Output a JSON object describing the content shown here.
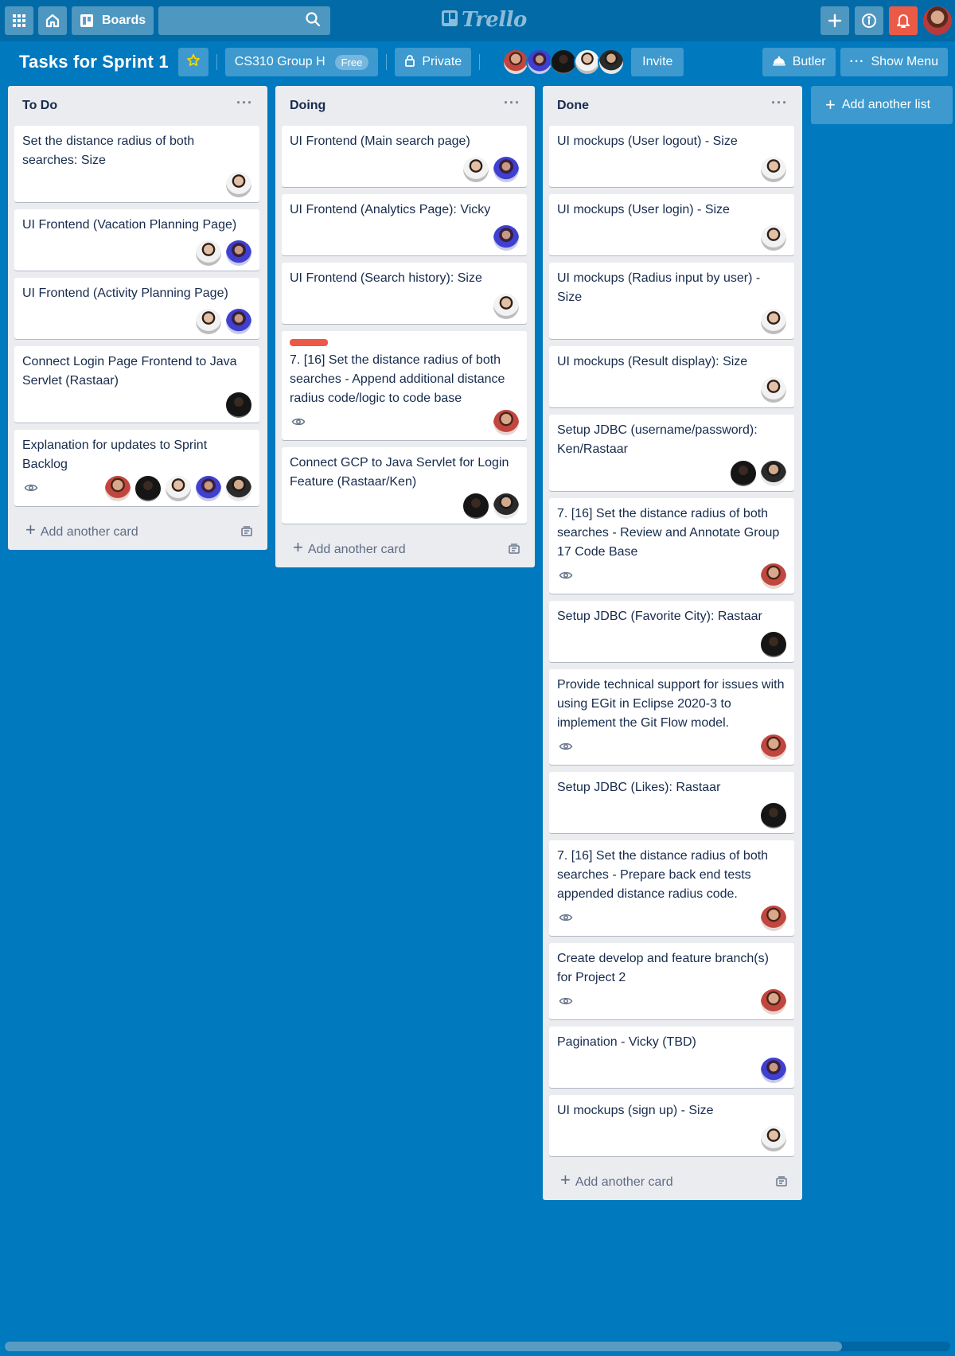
{
  "header": {
    "boards_label": "Boards",
    "search_value": "",
    "logo_text": "Trello"
  },
  "board": {
    "title": "Tasks for Sprint 1",
    "team": "CS310 Group H",
    "team_badge": "Free",
    "visibility": "Private",
    "invite": "Invite",
    "butler": "Butler",
    "show_menu": "Show Menu",
    "members": [
      "red-shirt",
      "blue-dress",
      "dark",
      "white-shirt",
      "suit"
    ]
  },
  "lists": [
    {
      "title": "To Do",
      "add_card": "Add another card",
      "cards": [
        {
          "title": "Set the distance radius of both searches: Size",
          "members": [
            "white-shirt"
          ],
          "watch": false,
          "label": false
        },
        {
          "title": "UI Frontend (Vacation Planning Page)",
          "members": [
            "white-shirt",
            "blue-dress"
          ],
          "watch": false,
          "label": false
        },
        {
          "title": "UI Frontend (Activity Planning Page)",
          "members": [
            "white-shirt",
            "blue-dress"
          ],
          "watch": false,
          "label": false
        },
        {
          "title": "Connect Login Page Frontend to Java Servlet (Rastaar)",
          "members": [
            "dark"
          ],
          "watch": false,
          "label": false
        },
        {
          "title": "Explanation for updates to Sprint Backlog",
          "members": [
            "red-shirt",
            "dark",
            "white-shirt",
            "blue-dress",
            "suit"
          ],
          "watch": true,
          "label": false
        }
      ]
    },
    {
      "title": "Doing",
      "add_card": "Add another card",
      "cards": [
        {
          "title": "UI Frontend (Main search page)",
          "members": [
            "white-shirt",
            "blue-dress"
          ],
          "watch": false,
          "label": false
        },
        {
          "title": "UI Frontend (Analytics Page): Vicky",
          "members": [
            "blue-dress"
          ],
          "watch": false,
          "label": false
        },
        {
          "title": "UI Frontend (Search history): Size",
          "members": [
            "white-shirt"
          ],
          "watch": false,
          "label": false
        },
        {
          "title": "7. [16] Set the distance radius of both searches - Append additional distance radius code/logic to code base",
          "members": [
            "red-shirt"
          ],
          "watch": true,
          "label": true
        },
        {
          "title": "Connect GCP to Java Servlet for Login Feature (Rastaar/Ken)",
          "members": [
            "dark",
            "suit"
          ],
          "watch": false,
          "label": false
        }
      ]
    },
    {
      "title": "Done",
      "add_card": "Add another card",
      "cards": [
        {
          "title": "UI mockups (User logout) - Size",
          "members": [
            "white-shirt"
          ],
          "watch": false,
          "label": false
        },
        {
          "title": "UI mockups (User login) - Size",
          "members": [
            "white-shirt"
          ],
          "watch": false,
          "label": false
        },
        {
          "title": "UI mockups (Radius input by user) - Size",
          "members": [
            "white-shirt"
          ],
          "watch": false,
          "label": false
        },
        {
          "title": "UI mockups (Result display): Size",
          "members": [
            "white-shirt"
          ],
          "watch": false,
          "label": false
        },
        {
          "title": "Setup JDBC (username/password): Ken/Rastaar",
          "members": [
            "dark",
            "suit"
          ],
          "watch": false,
          "label": false
        },
        {
          "title": "7. [16] Set the distance radius of both searches - Review and Annotate Group 17 Code Base",
          "members": [
            "red-shirt"
          ],
          "watch": true,
          "label": false
        },
        {
          "title": "Setup JDBC (Favorite City): Rastaar",
          "members": [
            "dark"
          ],
          "watch": false,
          "label": false
        },
        {
          "title": "Provide technical support for issues with using EGit in Eclipse 2020-3 to implement the Git Flow model.",
          "members": [
            "red-shirt"
          ],
          "watch": true,
          "label": false
        },
        {
          "title": "Setup JDBC (Likes): Rastaar",
          "members": [
            "dark"
          ],
          "watch": false,
          "label": false
        },
        {
          "title": "7. [16] Set the distance radius of both searches - Prepare back end tests appended distance radius code.",
          "members": [
            "red-shirt"
          ],
          "watch": true,
          "label": false
        },
        {
          "title": "Create develop and feature branch(s) for Project 2",
          "members": [
            "red-shirt"
          ],
          "watch": true,
          "label": false
        },
        {
          "title": "Pagination - Vicky (TBD)",
          "members": [
            "blue-dress"
          ],
          "watch": false,
          "label": false
        },
        {
          "title": "UI mockups (sign up) - Size",
          "members": [
            "white-shirt"
          ],
          "watch": false,
          "label": false
        }
      ]
    }
  ],
  "add_list": "Add another list",
  "colors": {
    "board_bg": "#0079bf",
    "header_bg": "#026aa7",
    "notify": "#eb5a46",
    "label_red": "#eb5a46",
    "star": "#f2d600"
  }
}
